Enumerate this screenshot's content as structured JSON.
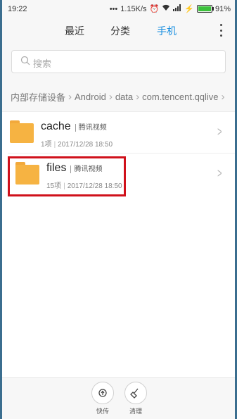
{
  "status_bar": {
    "time": "19:22",
    "speed": "1.15K/s",
    "battery": "91%",
    "battery_level": 0.91
  },
  "tabs": {
    "recent": "最近",
    "category": "分类",
    "phone": "手机"
  },
  "search": {
    "placeholder": "搜索"
  },
  "breadcrumb": {
    "items": [
      "内部存储设备",
      "Android",
      "data",
      "com.tencent.qqlive"
    ]
  },
  "files": [
    {
      "name": "cache",
      "tag": "腾讯视频",
      "count": "1项",
      "date": "2017/12/28 18:50"
    },
    {
      "name": "files",
      "tag": "腾讯视频",
      "count": "15项",
      "date": "2017/12/28 18:50"
    }
  ],
  "bottom_bar": {
    "transfer": "快传",
    "clean": "清理"
  }
}
